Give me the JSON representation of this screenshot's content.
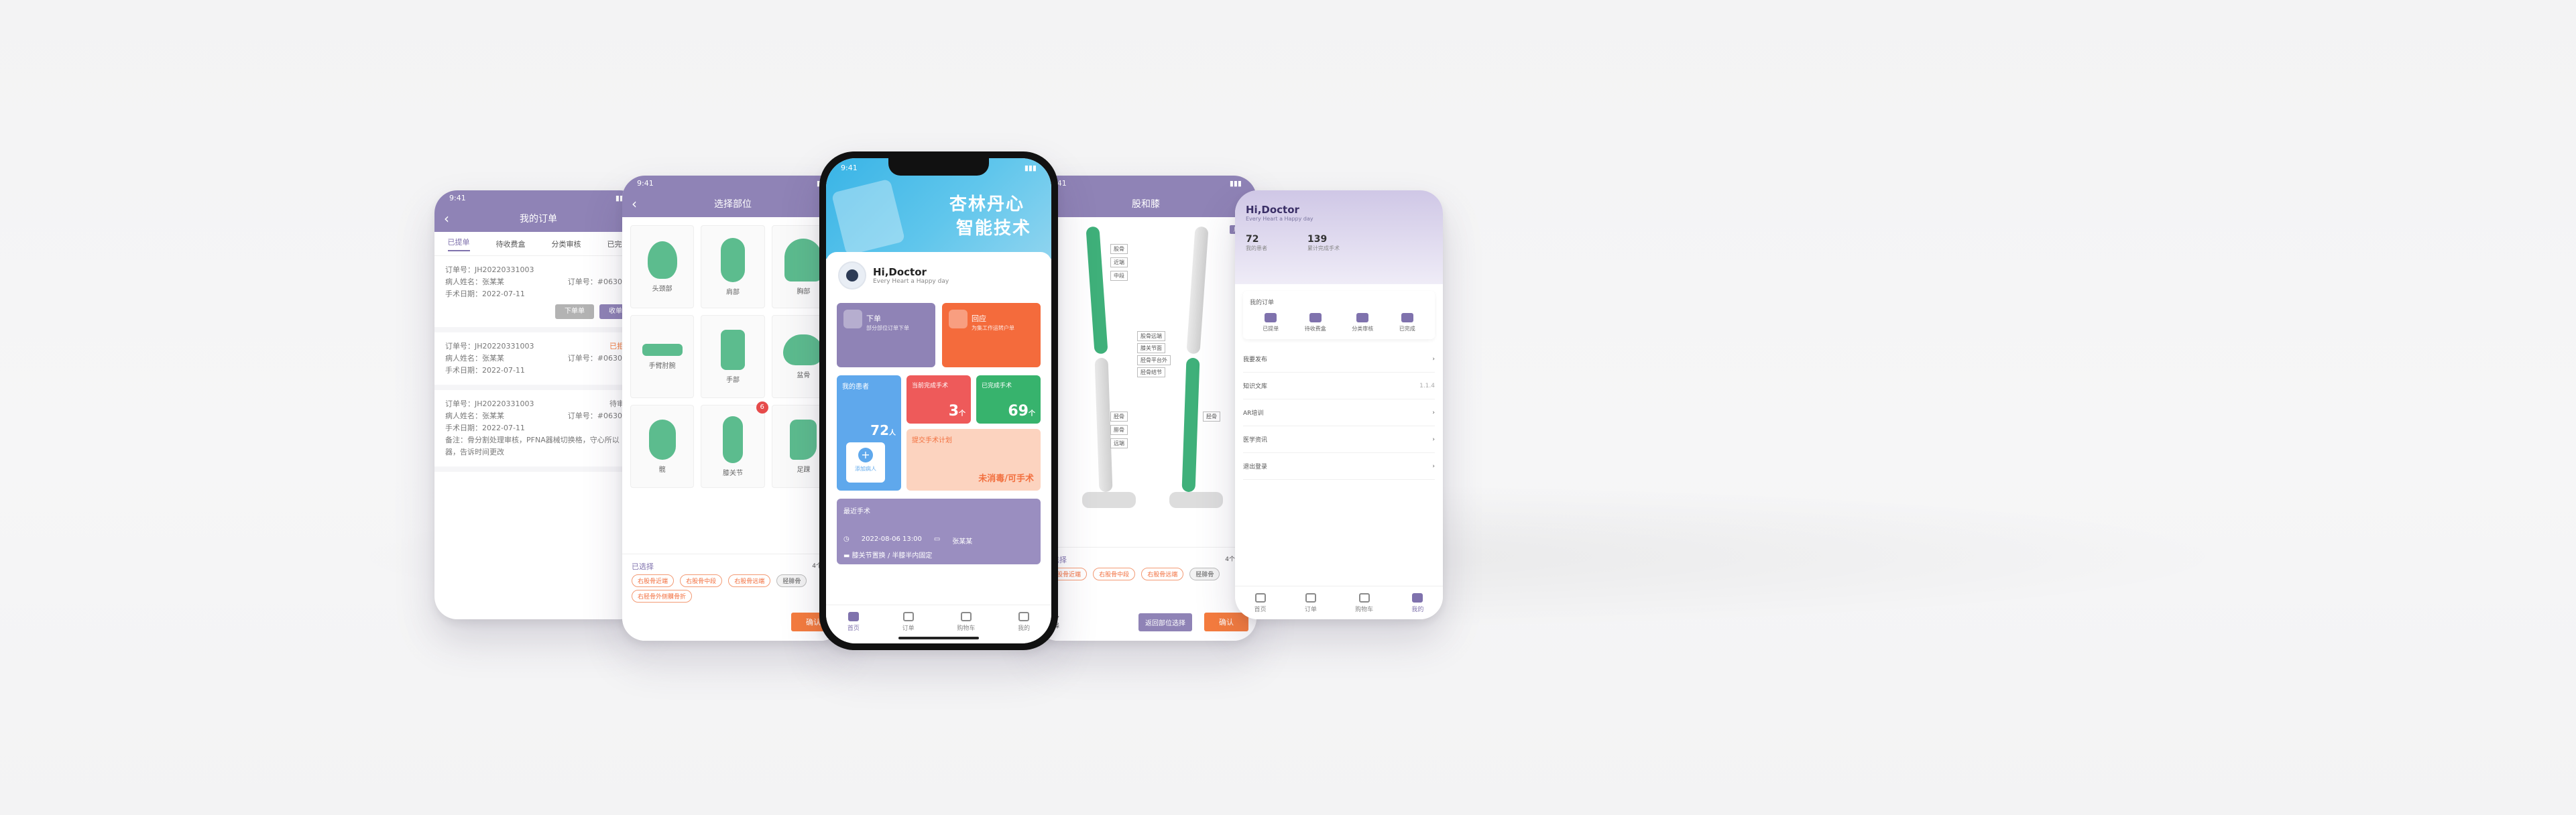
{
  "status_time": "9:41",
  "orders_screen": {
    "title": "我的订单",
    "tabs": [
      "已提单",
      "待收费盒",
      "分类审核",
      "已完成"
    ],
    "orders": [
      {
        "no_label": "订单号：",
        "no": "JH20220331003",
        "status": "",
        "patient": "病人姓名：张某某",
        "order_id": "订单号：#063065",
        "date": "手术日期：2022-07-11",
        "buttons": [
          "下单单",
          "收单"
        ]
      },
      {
        "no_label": "订单号：",
        "no": "JH20220331003",
        "status": "已拒单",
        "patient": "病人姓名：张某某",
        "order_id": "订单号：#063065",
        "date": "手术日期：2022-07-11",
        "buttons": []
      },
      {
        "no_label": "订单号：",
        "no": "JH20220331003",
        "status": "待审核",
        "patient": "病人姓名：张某某",
        "order_id": "订单号：#063065",
        "date": "手术日期：2022-07-11",
        "note": "备注：骨分割处理审核，PFNA器械切换格，守心所以器，告诉时间更改",
        "buttons": []
      }
    ]
  },
  "select_screen": {
    "title": "选择部位",
    "cells": [
      {
        "label": "头颈部"
      },
      {
        "label": "肩部"
      },
      {
        "label": "胸部"
      },
      {
        "label": "手臂肘腕"
      },
      {
        "label": "手部"
      },
      {
        "label": "盆骨"
      },
      {
        "label": "髋"
      },
      {
        "label": "膝关节",
        "badge": "6"
      },
      {
        "label": "足踝"
      }
    ],
    "selected_label": "已选择",
    "selected_count": "4个部位",
    "chips": [
      "右股骨近端",
      "右股骨中段",
      "右股骨远端",
      "胫腓骨",
      "右胫骨外侧髁骨折"
    ],
    "confirm": "确认"
  },
  "home_screen": {
    "banner_line1": "杏林丹心",
    "banner_line2": "智能技术",
    "hello": "Hi,Doctor",
    "hello_sub": "Every Heart a Happy day",
    "card_order": "下单",
    "card_order_sub": "部分部位订单下单",
    "card_return": "回应",
    "card_return_sub": "为集工作运转户单",
    "my_patients_label": "我的患者",
    "my_patients_value": "72",
    "my_patients_unit": "人",
    "add_patient": "添加病人",
    "pending_label": "当前完成手术",
    "pending_value": "3",
    "pending_unit": "个",
    "done_label": "已完成手术",
    "done_value": "69",
    "done_unit": "个",
    "todo_label": "提交手术计划",
    "todo_sub": "未消毒/可手术",
    "recent_title": "最近手术",
    "recent_date": "2022-08-06  13:00",
    "recent_doc": "张某某",
    "recent_desc": "膝关节置换 / 半膝半内固定",
    "tabbar": [
      "首页",
      "订单",
      "购物车",
      "我的"
    ]
  },
  "legs_screen": {
    "title": "股和膝",
    "corner": "展示",
    "labels": [
      "股骨",
      "近端",
      "中段",
      "远端",
      "股骨远端",
      "膝关节面",
      "胫骨平台外",
      "胫骨结节",
      "胫骨",
      "腓骨",
      "远端",
      "胫骨"
    ],
    "left_buttons": [
      "更多",
      "选择"
    ],
    "bottom_left": "已选择",
    "count": "4个部位",
    "chips": [
      "右股骨近端",
      "右股骨中段",
      "右股骨远端",
      "胫腓骨"
    ],
    "reset": "返回部位选择",
    "confirm": "确认"
  },
  "profile_screen": {
    "name": "Hi,Doctor",
    "sub": "Every Heart a Happy day",
    "stat1_value": "72",
    "stat1_label": "我的患者",
    "stat2_value": "139",
    "stat2_label": "累计完成手术",
    "order_title": "我的订单",
    "order_icons": [
      "已提单",
      "待收费盒",
      "分类审核",
      "已完成"
    ],
    "menu": [
      "我要发布",
      "知识文库",
      "AR培训",
      "医学资讯",
      "退出登录"
    ],
    "menu_value": "1.1.4",
    "tabbar": [
      "首页",
      "订单",
      "购物车",
      "我的"
    ]
  },
  "colors": {
    "accent": "#8f83b6",
    "orange": "#f46b3c",
    "green": "#3fb07a",
    "blue": "#5fa8ec",
    "red": "#ee5a5a"
  }
}
